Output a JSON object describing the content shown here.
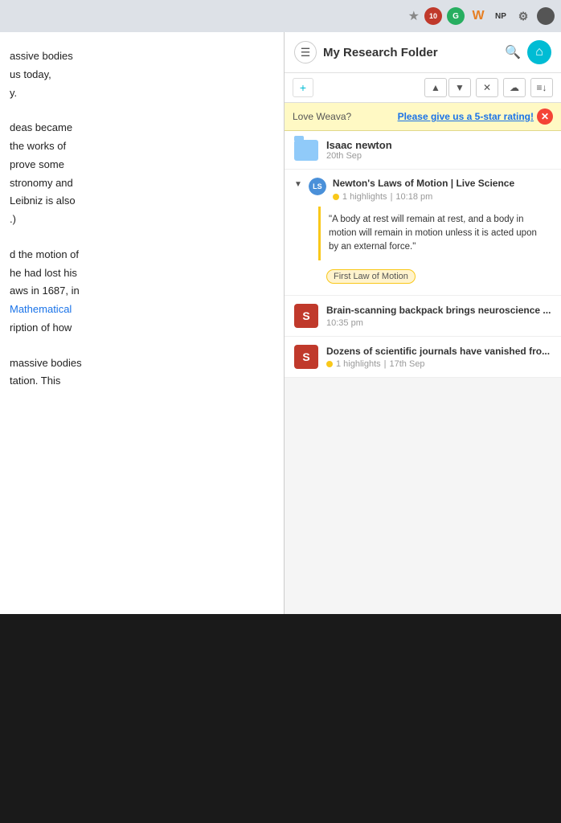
{
  "browser": {
    "star_icon": "★",
    "ext_badge": "10",
    "ext_g": "G",
    "ext_w": "W",
    "ext_np": "NP",
    "ext_puzzle": "⚙",
    "menu_icon": "☰"
  },
  "article": {
    "lines": [
      "assive bodies",
      "us today,",
      "y.",
      "",
      "deas became",
      "the works of",
      "prove some",
      "stronomy and",
      "Leibniz is also",
      ".)",
      "",
      "d the motion of",
      "he had lost his",
      "aws in 1687, in",
      "Mathematical",
      "ription of how",
      "",
      "massive bodies",
      "tation. This"
    ],
    "blue_link_text": "Mathematical",
    "blue_link_line": 14
  },
  "panel": {
    "title": "My Research Folder",
    "toolbar": {
      "add_icon": "+",
      "up_icon": "▲",
      "down_icon": "▼",
      "close_icon": "✕",
      "cloud_icon": "☁",
      "list_icon": "≡"
    },
    "banner": {
      "text": "Love Weava?",
      "link_text": "Please give us a 5-star rating!",
      "close_icon": "✕"
    },
    "folder": {
      "name": "Isaac newton",
      "date": "20th Sep"
    },
    "source": {
      "title": "Newton's Laws of Motion | Live Science",
      "highlights_count": "1 highlights",
      "time": "10:18 pm",
      "quote": "\"A body at rest will remain at rest, and a body in motion will remain in motion unless it is acted upon by an external force.\"",
      "tag": "First Law of Motion"
    },
    "news_items": [
      {
        "title": "Brain-scanning backpack brings neuroscience ...",
        "time": "10:35 pm",
        "highlights": null
      },
      {
        "title": "Dozens of scientific journals have vanished fro...",
        "highlights": "1 highlights",
        "date": "17th Sep"
      }
    ]
  }
}
